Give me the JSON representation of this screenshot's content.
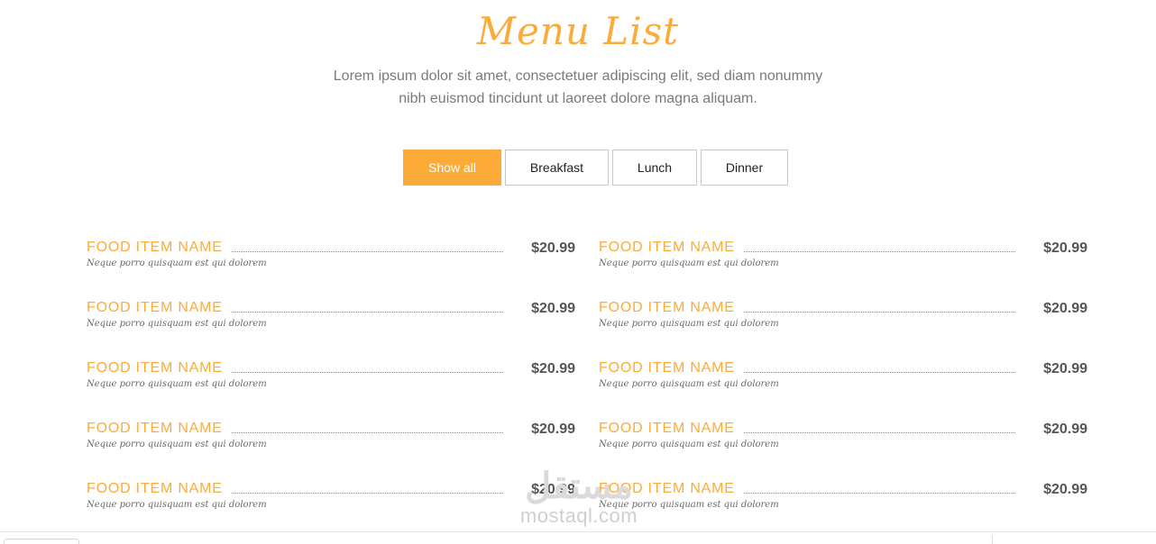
{
  "header": {
    "title": "Menu List",
    "subtitle_line1": "Lorem ipsum dolor sit amet, consectetuer adipiscing elit, sed diam nonummy",
    "subtitle_line2": "nibh euismod tincidunt ut laoreet dolore magna aliquam."
  },
  "filters": [
    {
      "label": "Show all",
      "active": true
    },
    {
      "label": "Breakfast",
      "active": false
    },
    {
      "label": "Lunch",
      "active": false
    },
    {
      "label": "Dinner",
      "active": false
    }
  ],
  "menu": {
    "left": [
      {
        "name": "FOOD ITEM NAME",
        "desc": "Neque porro quisquam est qui dolorem",
        "price": "$20.99"
      },
      {
        "name": "FOOD ITEM NAME",
        "desc": "Neque porro quisquam est qui dolorem",
        "price": "$20.99"
      },
      {
        "name": "FOOD ITEM NAME",
        "desc": "Neque porro quisquam est qui dolorem",
        "price": "$20.99"
      },
      {
        "name": "FOOD ITEM NAME",
        "desc": "Neque porro quisquam est qui dolorem",
        "price": "$20.99"
      },
      {
        "name": "FOOD ITEM NAME",
        "desc": "Neque porro quisquam est qui dolorem",
        "price": "$20.99"
      }
    ],
    "right": [
      {
        "name": "FOOD ITEM NAME",
        "desc": "Neque porro quisquam est qui dolorem",
        "price": "$20.99"
      },
      {
        "name": "FOOD ITEM NAME",
        "desc": "Neque porro quisquam est qui dolorem",
        "price": "$20.99"
      },
      {
        "name": "FOOD ITEM NAME",
        "desc": "Neque porro quisquam est qui dolorem",
        "price": "$20.99"
      },
      {
        "name": "FOOD ITEM NAME",
        "desc": "Neque porro quisquam est qui dolorem",
        "price": "$20.99"
      },
      {
        "name": "FOOD ITEM NAME",
        "desc": "Neque porro quisquam est qui dolorem",
        "price": "$20.99"
      }
    ]
  },
  "watermark": {
    "arabic": "مستقل",
    "latin": "mostaql.com"
  },
  "colors": {
    "accent": "#fdab38",
    "text_muted": "#7a7a7a",
    "price": "#555555"
  }
}
